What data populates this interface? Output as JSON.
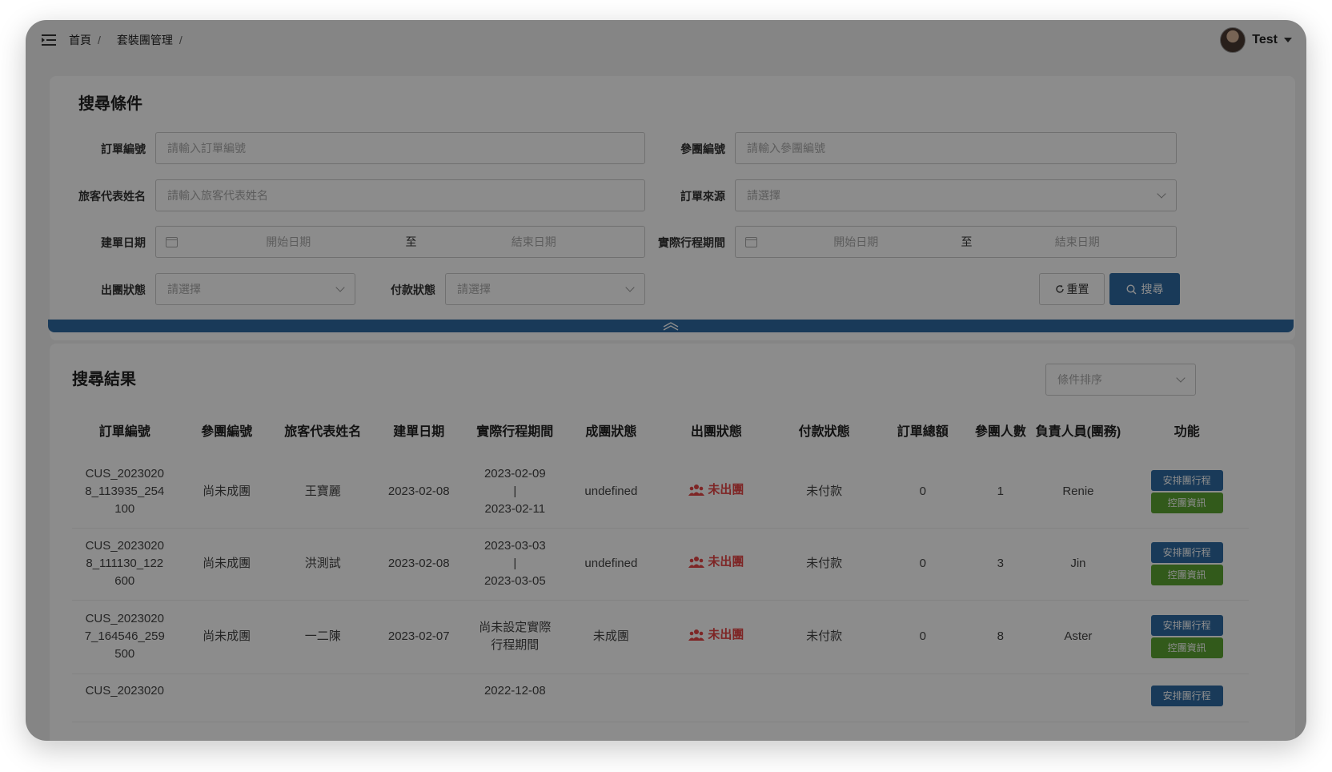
{
  "colors": {
    "primary": "#2e6ba3",
    "success": "#5ca532",
    "danger": "#e64545"
  },
  "breadcrumb": {
    "items": [
      "首頁",
      "套裝團管理"
    ],
    "separator": "/"
  },
  "user": {
    "name": "Test"
  },
  "search": {
    "title": "搜尋條件",
    "order_no_label": "訂單編號",
    "order_no_placeholder": "請輸入訂單編號",
    "group_no_label": "參團編號",
    "group_no_placeholder": "請輸入參團編號",
    "rep_name_label": "旅客代表姓名",
    "rep_name_placeholder": "請輸入旅客代表姓名",
    "source_label": "訂單來源",
    "source_placeholder": "請選擇",
    "created_label": "建單日期",
    "created_start": "開始日期",
    "created_to": "至",
    "created_end": "結束日期",
    "trip_label": "實際行程期間",
    "trip_start": "開始日期",
    "trip_to": "至",
    "trip_end": "結束日期",
    "depart_label": "出團狀態",
    "depart_placeholder": "請選擇",
    "pay_label": "付款狀態",
    "pay_placeholder": "請選擇",
    "reset_label": "重置",
    "search_label": "搜尋"
  },
  "results": {
    "title": "搜尋結果",
    "sort_placeholder": "條件排序",
    "headers": {
      "order_no": "訂單編號",
      "group_no": "參團編號",
      "rep_name": "旅客代表姓名",
      "created": "建單日期",
      "trip": "實際行程期間",
      "group_status": "成團狀態",
      "depart_status": "出團狀態",
      "pay_status": "付款狀態",
      "total": "訂單總額",
      "people": "參團人數",
      "owner": "負責人員(團務)",
      "actions": "功能"
    },
    "btn_arrange": "安排團行程",
    "btn_info": "控團資訊",
    "rows": [
      {
        "order_no_1": "CUS_2023020",
        "order_no_2": "8_113935_254",
        "order_no_3": "100",
        "group_no": "尚未成團",
        "rep": "王寶麗",
        "created": "2023-02-08",
        "trip_start": "2023-02-09",
        "trip_sep": "|",
        "trip_end": "2023-02-11",
        "group_status": "undefined",
        "depart": "未出團",
        "pay": "未付款",
        "total": "0",
        "people": "1",
        "owner": "Renie"
      },
      {
        "order_no_1": "CUS_2023020",
        "order_no_2": "8_111130_122",
        "order_no_3": "600",
        "group_no": "尚未成團",
        "rep": "洪測試",
        "created": "2023-02-08",
        "trip_start": "2023-03-03",
        "trip_sep": "|",
        "trip_end": "2023-03-05",
        "group_status": "undefined",
        "depart": "未出團",
        "pay": "未付款",
        "total": "0",
        "people": "3",
        "owner": "Jin"
      },
      {
        "order_no_1": "CUS_2023020",
        "order_no_2": "7_164546_259",
        "order_no_3": "500",
        "group_no": "尚未成團",
        "rep": "一二陳",
        "created": "2023-02-07",
        "trip_note_1": "尚未設定實際",
        "trip_note_2": "行程期間",
        "group_status": "未成團",
        "depart": "未出團",
        "pay": "未付款",
        "total": "0",
        "people": "8",
        "owner": "Aster"
      },
      {
        "order_no_1": "CUS_2023020",
        "trip_start": "2022-12-08"
      }
    ]
  }
}
